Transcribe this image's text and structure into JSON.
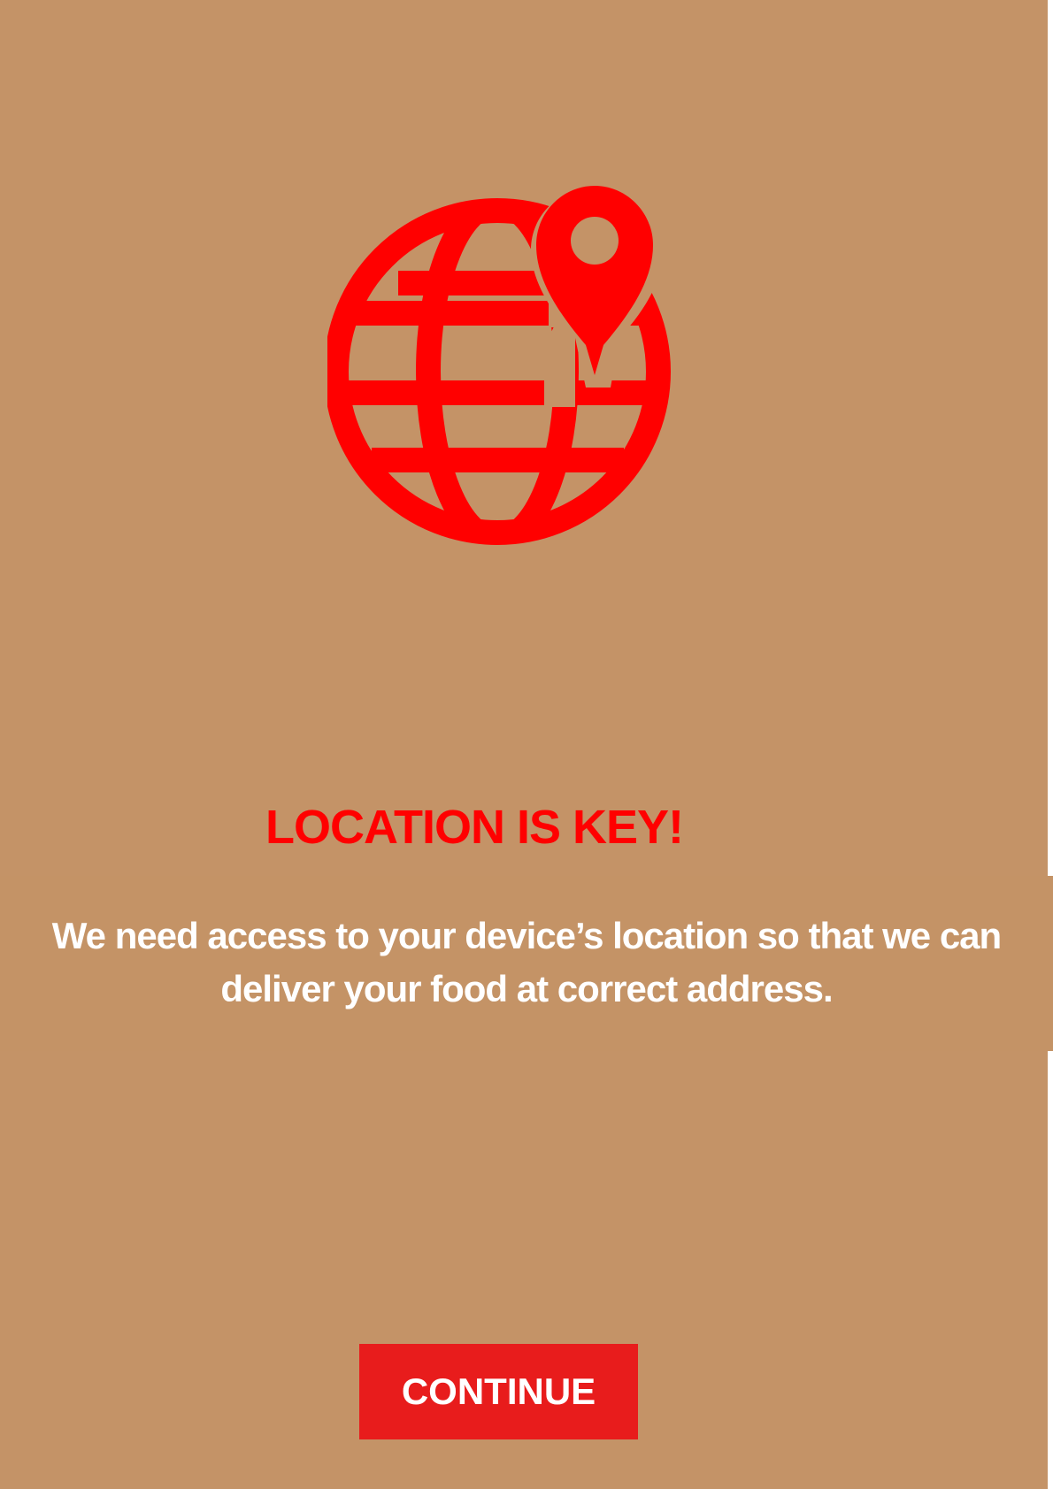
{
  "screen": {
    "background_color": "#c49367"
  },
  "hero": {
    "icon": "globe-location-pin-icon",
    "icon_color": "#ff0000"
  },
  "title": "LOCATION IS KEY!",
  "message": "We need access to your device’s location so that we can deliver your food at correct address.",
  "continue_button": {
    "label": "CONTINUE",
    "color": "#e81c1c"
  }
}
